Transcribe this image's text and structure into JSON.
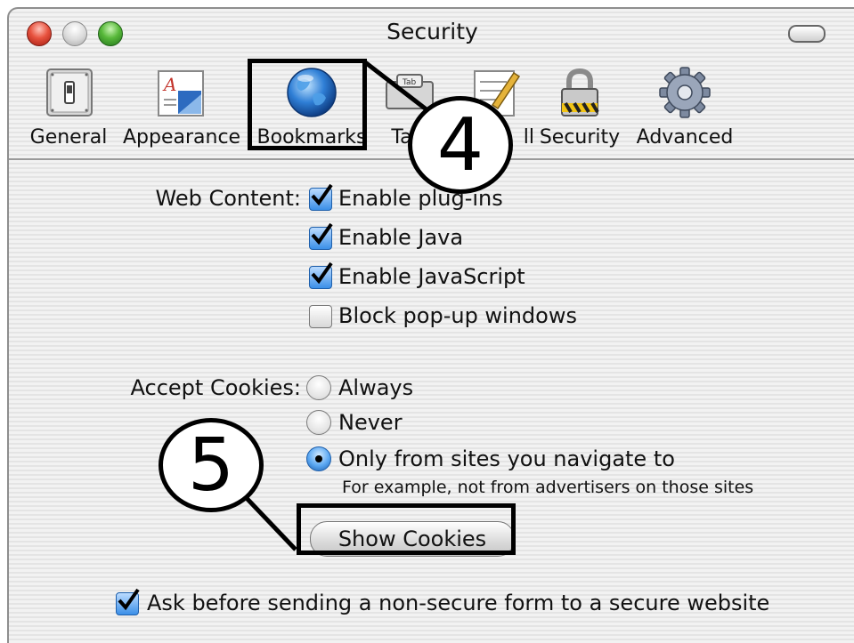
{
  "window": {
    "title": "Security"
  },
  "toolbar": {
    "items": [
      {
        "label": "General",
        "icon": "switch-icon"
      },
      {
        "label": "Appearance",
        "icon": "appearance-icon"
      },
      {
        "label": "Bookmarks",
        "icon": "globe-icon"
      },
      {
        "label": "Tab",
        "icon": "tab-icon"
      },
      {
        "label": "ll",
        "icon": "autofill-icon"
      },
      {
        "label": "Security",
        "icon": "lock-icon"
      },
      {
        "label": "Advanced",
        "icon": "gear-icon"
      }
    ]
  },
  "web_content": {
    "label": "Web Content:",
    "options": [
      {
        "label": "Enable plug-ins",
        "checked": true
      },
      {
        "label": "Enable Java",
        "checked": true
      },
      {
        "label": "Enable JavaScript",
        "checked": true
      },
      {
        "label": "Block pop-up windows",
        "checked": false
      }
    ]
  },
  "cookies": {
    "label": "Accept Cookies:",
    "options": [
      {
        "label": "Always",
        "selected": false
      },
      {
        "label": "Never",
        "selected": false
      },
      {
        "label": "Only from sites you navigate to",
        "selected": true
      }
    ],
    "note": "For example, not from advertisers on those sites",
    "show_button": "Show Cookies"
  },
  "form_warning": {
    "label": "Ask before sending a non-secure form to a secure website",
    "checked": true
  },
  "callouts": {
    "four": "4",
    "five": "5"
  },
  "colors": {
    "accent": "#3b8fe8",
    "annotation": "#000000"
  }
}
